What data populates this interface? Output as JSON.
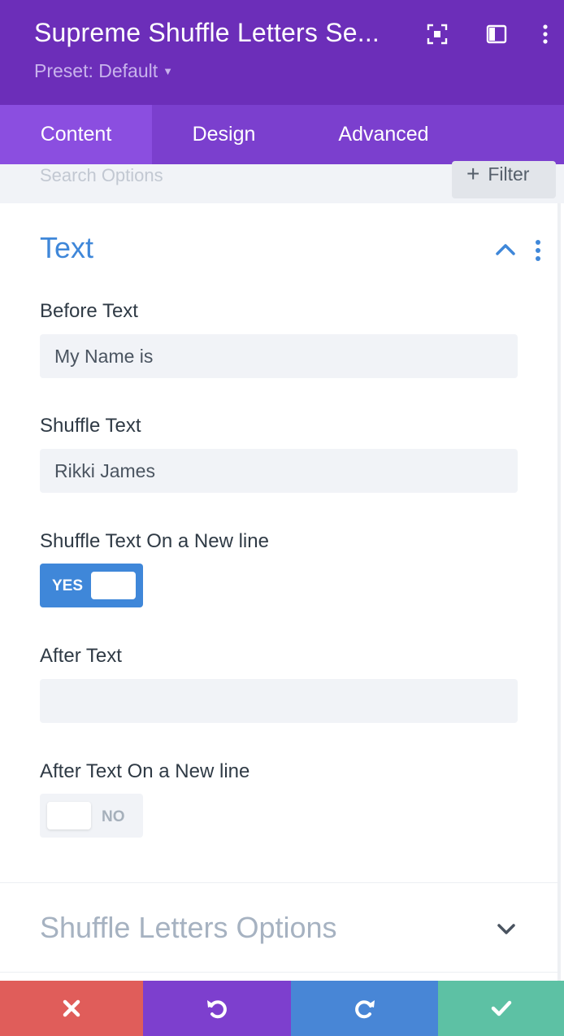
{
  "header": {
    "title": "Supreme Shuffle Letters Se...",
    "preset": "Preset: Default",
    "icons": [
      "fullscreen-icon",
      "split-view-icon",
      "more-vertical-icon"
    ]
  },
  "tabs": [
    {
      "label": "Content",
      "active": true
    },
    {
      "label": "Design",
      "active": false
    },
    {
      "label": "Advanced",
      "active": false
    }
  ],
  "search": {
    "placeholder": "Search Options",
    "filter_label": "Filter"
  },
  "section_text": {
    "title": "Text",
    "fields": {
      "before_text": {
        "label": "Before Text",
        "value": "My Name is"
      },
      "shuffle_text": {
        "label": "Shuffle Text",
        "value": "Rikki James"
      },
      "shuffle_newline": {
        "label": "Shuffle Text On a New line",
        "state": "YES"
      },
      "after_text": {
        "label": "After Text",
        "value": ""
      },
      "after_newline": {
        "label": "After Text On a New line",
        "state": "NO"
      }
    }
  },
  "section_options": {
    "title": "Shuffle Letters Options"
  },
  "footer": {
    "buttons": [
      "close-icon",
      "undo-icon",
      "redo-icon",
      "check-icon"
    ]
  },
  "colors": {
    "header": "#6c2eb9",
    "tabs": "#7b3fce",
    "active_tab": "#8b4ee0",
    "accent": "#3f87d9",
    "cancel": "#e05d5a",
    "undo": "#7d3fce",
    "redo": "#4886d6",
    "save": "#5dc1a4"
  }
}
